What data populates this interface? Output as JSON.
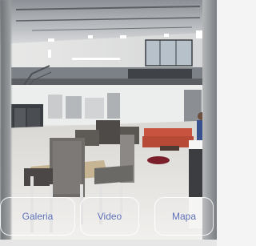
{
  "viewer": {
    "tabs": [
      {
        "label": "Galeria"
      },
      {
        "label": "Video"
      },
      {
        "label": "Mapa"
      }
    ]
  },
  "colors": {
    "tab_text": "#5d6fb6",
    "tab_border": "#ffffff"
  }
}
